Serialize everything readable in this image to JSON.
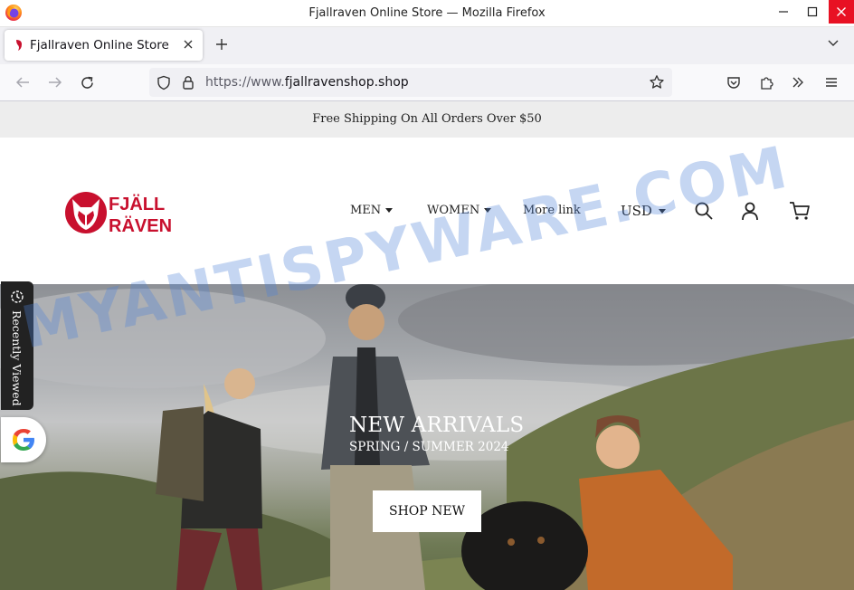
{
  "window": {
    "title": "Fjallraven Online Store — Mozilla Firefox"
  },
  "tab": {
    "title": "Fjallraven Online Store"
  },
  "navbar": {
    "url_prefix": "https://www.",
    "url_host": "fjallravenshop.shop"
  },
  "announcement": {
    "text": "Free Shipping On All Orders Over $50"
  },
  "brand": {
    "logo_top": "FJÄLL",
    "logo_bottom": "RÄVEN",
    "color": "#c8102e"
  },
  "menu": {
    "items": [
      {
        "label": "MEN",
        "dropdown": true
      },
      {
        "label": "WOMEN",
        "dropdown": true
      },
      {
        "label": "More link",
        "dropdown": false
      }
    ],
    "currency": "USD"
  },
  "hero": {
    "title": "NEW ARRIVALS",
    "subtitle": "SPRING / SUMMER 2024",
    "button": "SHOP NEW"
  },
  "widgets": {
    "recently_viewed": "Recently Viewed"
  },
  "watermark": {
    "text": "MYANTISPYWARE.COM"
  },
  "icons": {
    "browser": "firefox-logo-icon",
    "back": "arrow-left-icon",
    "forward": "arrow-right-icon",
    "reload": "reload-icon",
    "security": "shield-icon",
    "lock": "lock-icon",
    "bookmark": "star-icon",
    "pocket": "pocket-icon",
    "extensions": "puzzle-icon",
    "overflow": "double-chevron-icon",
    "menu": "hamburger-icon",
    "search": "search-icon",
    "account": "user-icon",
    "cart": "cart-icon"
  }
}
